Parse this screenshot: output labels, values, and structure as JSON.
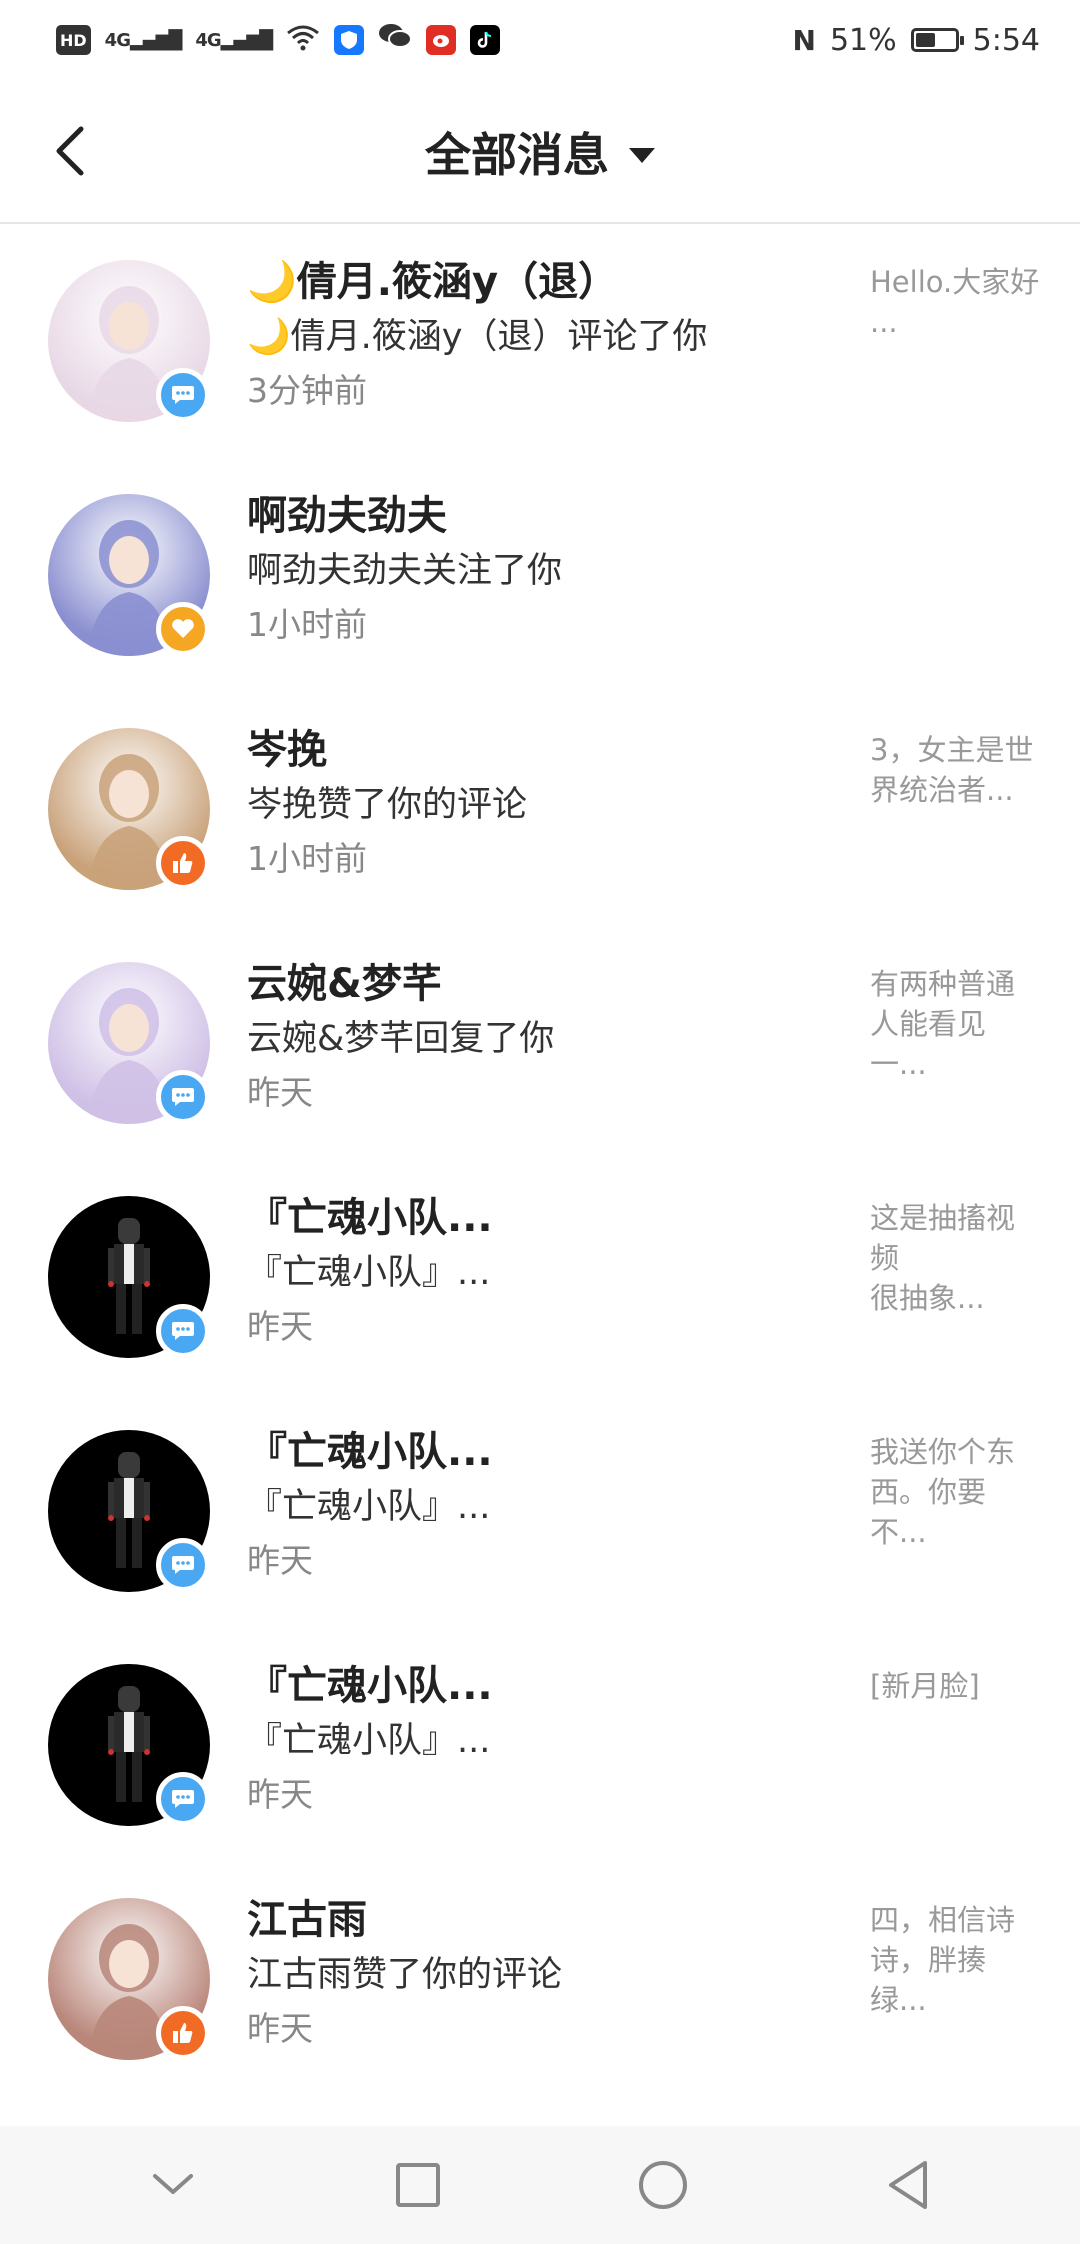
{
  "status_bar": {
    "hd": "HD",
    "signal1": "4G",
    "signal2": "4G",
    "nfc": "N",
    "battery_percent": "51%",
    "battery_level": 0.51,
    "time": "5:54",
    "icons": [
      "hd-icon",
      "signal-icon",
      "signal-icon",
      "wifi-icon",
      "shield-icon",
      "wechat-icon",
      "weibo-icon",
      "tiktok-icon",
      "nfc-icon",
      "battery-icon"
    ]
  },
  "header": {
    "title": "全部消息",
    "back_icon": "back-arrow-icon",
    "dropdown_icon": "caret-down-icon"
  },
  "messages": [
    {
      "name": "🌙倩月.筱涵y（退）",
      "action": "🌙倩月.筱涵y（退）评论了你",
      "time": "3分钟前",
      "preview": "Hello.大家好\n...",
      "type": "comment",
      "avatar_color": "#e8d8e6"
    },
    {
      "name": "啊劲夫劲夫",
      "action": "啊劲夫劲夫关注了你",
      "time": "1小时前",
      "preview": "",
      "type": "follow",
      "avatar_color": "#8a8fd0"
    },
    {
      "name": "岑挽",
      "action": "岑挽赞了你的评论",
      "time": "1小时前",
      "preview": "3，女主是世界统治者...",
      "type": "like",
      "avatar_color": "#c9a27a"
    },
    {
      "name": "云婉&梦芊",
      "action": "云婉&梦芊回复了你",
      "time": "昨天",
      "preview": "有两种普通人能看见一...",
      "type": "comment",
      "avatar_color": "#cfc0e6"
    },
    {
      "name": "『亡魂小队...",
      "action": "『亡魂小队』...",
      "time": "昨天",
      "preview": "这是抽搐视频\n很抽象...",
      "type": "comment",
      "avatar_color": "#000000"
    },
    {
      "name": "『亡魂小队...",
      "action": "『亡魂小队』...",
      "time": "昨天",
      "preview": "我送你个东西。你要不...",
      "type": "comment",
      "avatar_color": "#000000"
    },
    {
      "name": "『亡魂小队...",
      "action": "『亡魂小队』...",
      "time": "昨天",
      "preview": "[新月脸]",
      "type": "comment",
      "avatar_color": "#000000"
    },
    {
      "name": "江古雨",
      "action": "江古雨赞了你的评论",
      "time": "昨天",
      "preview": "四，相信诗诗，胖揍绿...",
      "type": "like",
      "avatar_color": "#b9867a"
    }
  ],
  "nav_bar": {
    "icons": [
      "hide-keyboard-icon",
      "recents-icon",
      "home-icon",
      "back-icon"
    ]
  },
  "colors": {
    "comment_badge": "#4aa7f2",
    "follow_badge": "#f5a623",
    "like_badge": "#f26b24"
  }
}
